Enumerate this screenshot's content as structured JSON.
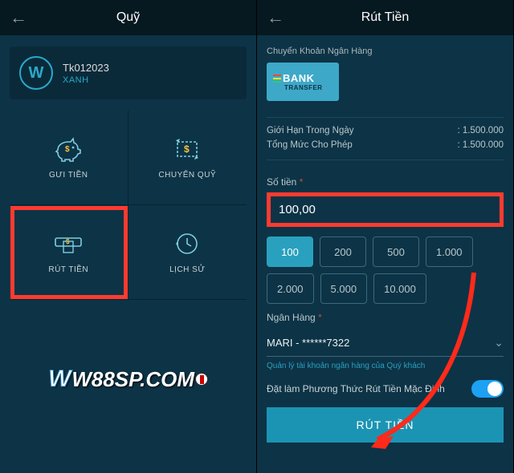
{
  "left": {
    "title": "Quỹ",
    "account_id": "Tk012023",
    "tier": "XANH",
    "logo_letter": "W",
    "tiles": {
      "deposit": "GƯI TIỀN",
      "transfer": "CHUYỂN QUỸ",
      "withdraw": "RÚT TIỀN",
      "history": "LỊCH SỬ"
    }
  },
  "right": {
    "title": "Rút Tiền",
    "bank_section": "Chuyển Khoản Ngân Hàng",
    "bank_badge_top": "BANK",
    "bank_badge_bottom": "TRANSFER",
    "daily_limit_label": "Giới Hạn Trong Ngày",
    "daily_limit_value": "1.500.000",
    "total_limit_label": "Tổng Mức Cho Phép",
    "total_limit_value": "1.500.000",
    "amount_label": "Số tiền",
    "amount_value": "100,00",
    "chips": [
      "100",
      "200",
      "500",
      "1.000",
      "2.000",
      "5.000",
      "10.000"
    ],
    "bank_label": "Ngân Hàng",
    "bank_value": "MARI - ******7322",
    "hint": "Quản lý tài khoản ngân hàng của Quý khách",
    "default_label": "Đặt làm Phương Thức Rút Tiền Mặc Định",
    "submit": "RÚT TIỀN"
  },
  "watermark": "W88SP.COM",
  "colors": {
    "accent": "#2aa0bf",
    "highlight": "#ff3b30"
  }
}
